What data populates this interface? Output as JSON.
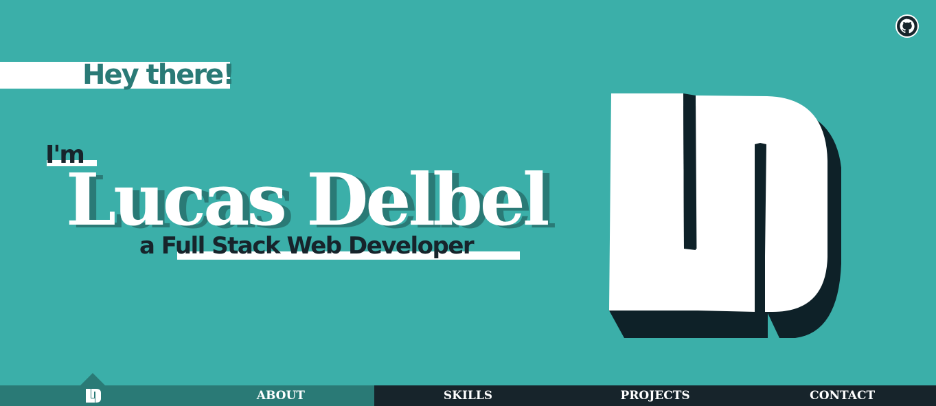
{
  "header": {
    "github_icon": "github-icon"
  },
  "hero": {
    "greeting": "Hey there!",
    "intro": "I'm",
    "name": "Lucas Delbel",
    "tagline": "a Full Stack Web Developer"
  },
  "logo": {
    "icon": "ld-monogram-logo"
  },
  "nav": {
    "home_icon": "ld-monogram-icon",
    "items": [
      "ABOUT",
      "SKILLS",
      "PROJECTS",
      "CONTACT"
    ]
  },
  "colors": {
    "background": "#3bafa9",
    "accent_dark": "#2a7a76",
    "navy": "#17242b",
    "white": "#ffffff"
  }
}
